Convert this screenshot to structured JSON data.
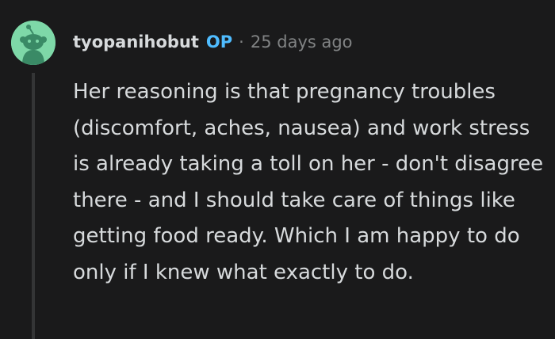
{
  "comment": {
    "author": "tyopanihobut",
    "op_badge": "OP",
    "separator": "·",
    "timestamp": "25 days ago",
    "body": "Her reasoning is that pregnancy troubles (discomfort, aches, nausea) and work stress is already taking a toll on her - don't disagree there - and I should take care of things like getting food ready. Which I am happy to do only if I knew what exactly to do."
  },
  "colors": {
    "background": "#1a1a1b",
    "text": "#d7dadc",
    "muted": "#818384",
    "op_badge": "#4fbcff",
    "avatar_bg": "#7ed8a8",
    "thread_line": "#343536"
  },
  "icons": {
    "avatar": "snoo-avatar-icon"
  }
}
